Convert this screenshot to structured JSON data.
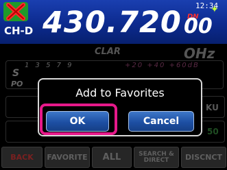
{
  "header": {
    "channel": "CH-D",
    "frequency_main": "430.720",
    "frequency_sub": "00",
    "mode_badge": "DN",
    "clock": "12:34"
  },
  "background": {
    "clar_label": "CLAR",
    "clar_value": "OHz",
    "meter_s_label": "S",
    "meter_po_label": "PO",
    "meter_scale": "1 3 5 7 9",
    "meter_scale_over": "+20 +40 +60dB",
    "side_label": "KU",
    "side_value": "50"
  },
  "function_bar": {
    "buttons": [
      {
        "label": "BACK"
      },
      {
        "label": "FAVORITE"
      },
      {
        "label": "ALL"
      },
      {
        "label_line1": "SEARCH &",
        "label_line2": "DIRECT"
      },
      {
        "label": "DISCNCT"
      }
    ]
  },
  "dialog": {
    "title": "Add to Favorites",
    "ok_label": "OK",
    "cancel_label": "Cancel"
  },
  "colors": {
    "header_blue": "#0c2a8e",
    "button_blue": "#1d4fa3",
    "highlight_pink": "#e6198a",
    "dn_red": "#ff3030",
    "gps_green": "#c8ff3a"
  },
  "icons": {
    "logo": "x-logo-icon",
    "gps": "gps-satellite-icon"
  }
}
